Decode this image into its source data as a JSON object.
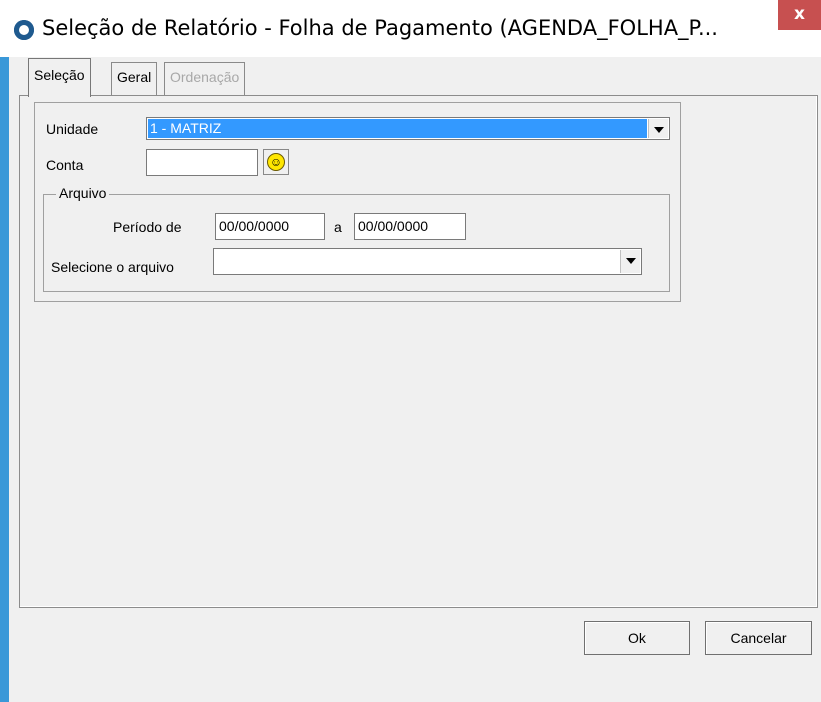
{
  "window": {
    "title": "Seleção de Relatório - Folha de Pagamento (AGENDA_FOLHA_P...",
    "close_label": "x"
  },
  "tabs": [
    {
      "label": "Seleção",
      "state": "active"
    },
    {
      "label": "Geral",
      "state": "normal"
    },
    {
      "label": "Ordenação",
      "state": "disabled"
    }
  ],
  "form": {
    "unidade_label": "Unidade",
    "unidade_value": "1 - MATRIZ",
    "conta_label": "Conta",
    "conta_value": "",
    "lookup_icon": "smiley-icon",
    "arquivo_legend": "Arquivo",
    "periodo_label": "Período de",
    "periodo_from": "00/00/0000",
    "periodo_sep": "a",
    "periodo_to": "00/00/0000",
    "selecione_label": "Selecione o arquivo",
    "selecione_value": ""
  },
  "buttons": {
    "ok": "Ok",
    "cancel": "Cancelar"
  },
  "colors": {
    "accent": "#3a98d8",
    "close": "#c75050",
    "selection": "#3399ff"
  }
}
